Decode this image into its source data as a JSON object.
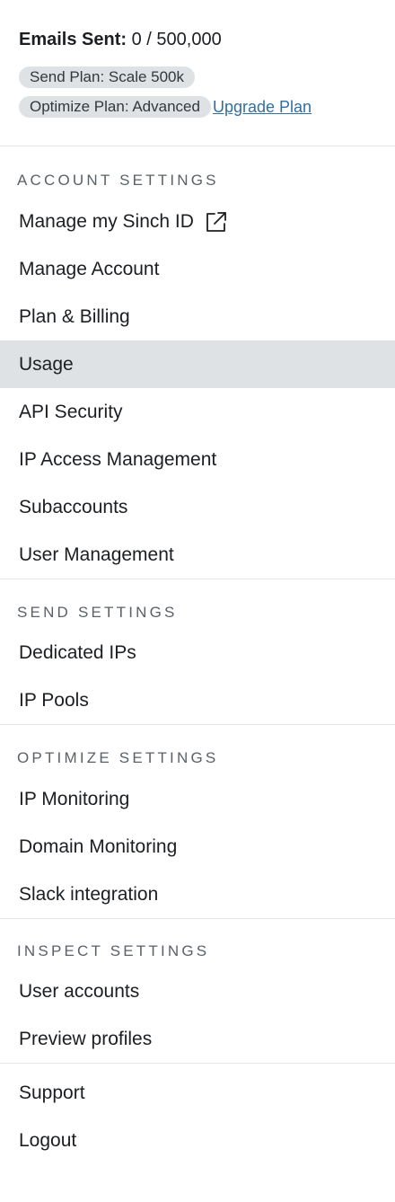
{
  "summary": {
    "emails_sent_label": "Emails Sent:",
    "emails_sent_value": "0 / 500,000",
    "send_plan_badge": "Send Plan: Scale 500k",
    "optimize_plan_badge": "Optimize Plan: Advanced",
    "upgrade_link": "Upgrade Plan"
  },
  "sections": {
    "account": {
      "title": "ACCOUNT SETTINGS",
      "items": [
        "Manage my Sinch ID",
        "Manage Account",
        "Plan & Billing",
        "Usage",
        "API Security",
        "IP Access Management",
        "Subaccounts",
        "User Management"
      ]
    },
    "send": {
      "title": "SEND SETTINGS",
      "items": [
        "Dedicated IPs",
        "IP Pools"
      ]
    },
    "optimize": {
      "title": "OPTIMIZE SETTINGS",
      "items": [
        "IP Monitoring",
        "Domain Monitoring",
        "Slack integration"
      ]
    },
    "inspect": {
      "title": "INSPECT SETTINGS",
      "items": [
        "User accounts",
        "Preview profiles"
      ]
    },
    "footer": {
      "items": [
        "Support",
        "Logout"
      ]
    }
  },
  "active_item": "Usage",
  "icons": {
    "external_link": "external-link-icon"
  },
  "colors": {
    "active_bg": "#dee2e5",
    "link": "#2f6fa3",
    "section_title": "#5a6168",
    "divider": "#e4e7ea"
  }
}
